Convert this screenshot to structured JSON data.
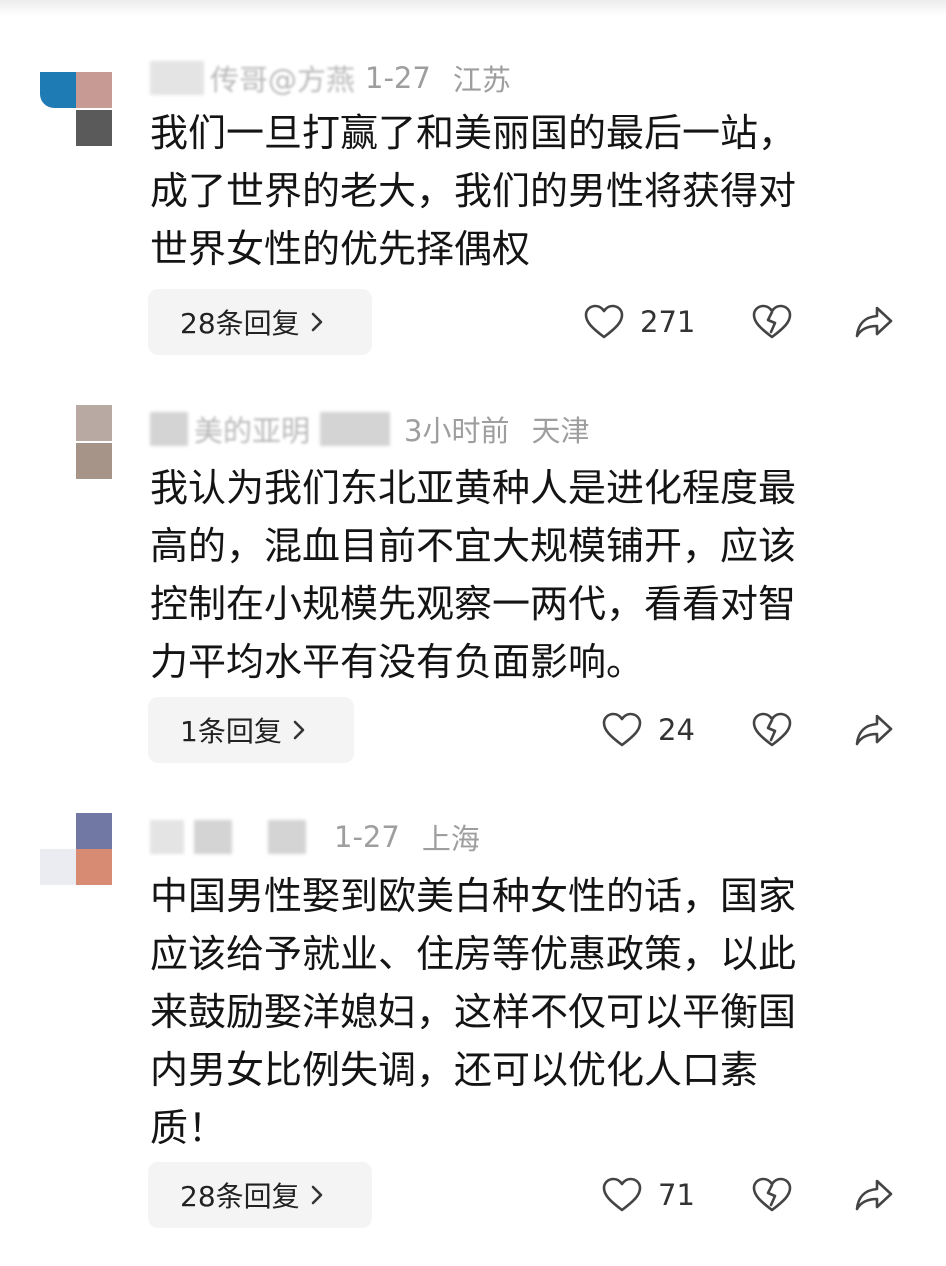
{
  "comments": [
    {
      "username": "传哥@方燕",
      "time": "1-27",
      "location": "江苏",
      "lines": [
        "我们一旦打赢了和美丽国的最后一站，",
        "成了世界的老大，我们的男性将获得对",
        "世界女性的优先择偶权"
      ],
      "reply_label": "28条回复",
      "likes": "271",
      "avatar_colors": [
        "#1f7bb3",
        "#c79b93",
        "#8c8c8c",
        "#5a5a5a"
      ]
    },
    {
      "username": "美的亚明",
      "time": "3小时前",
      "location": "天津",
      "lines": [
        "我认为我们东北亚黄种人是进化程度最",
        "高的，混血目前不宜大规模铺开，应该",
        "控制在小规模先观察一两代，看看对智",
        "力平均水平有没有负面影响。"
      ],
      "reply_label": "1条回复",
      "likes": "24",
      "avatar_colors": [
        "#b8a9a3",
        "#a69488"
      ]
    },
    {
      "username": "",
      "time": "1-27",
      "location": "上海",
      "lines": [
        "中国男性娶到欧美白种女性的话，国家",
        "应该给予就业、住房等优惠政策，以此",
        "来鼓励娶洋媳妇，这样不仅可以平衡国",
        "内男女比例失调，还可以优化人口素",
        "质！"
      ],
      "reply_label": "28条回复",
      "likes": "71",
      "avatar_colors": [
        "#7178a4",
        "#e8e8ee",
        "#d88b73",
        "#9aa0c0"
      ]
    }
  ],
  "icons": {
    "like": "heart-outline-icon",
    "dislike": "broken-heart-icon",
    "share": "share-arrow-icon",
    "more": "chevron-right-icon"
  }
}
